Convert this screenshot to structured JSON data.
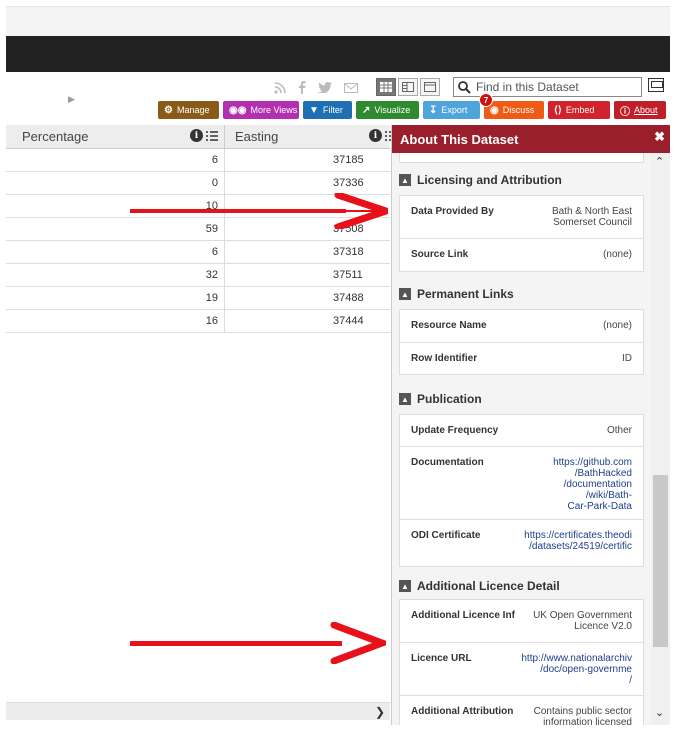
{
  "toolbar": {
    "search_placeholder": "Find in this Dataset",
    "buttons": {
      "manage": "Manage",
      "more_views": "More Views",
      "filter": "Filter",
      "visualize": "Visualize",
      "export": "Export",
      "discuss": "Discuss",
      "discuss_count": "7",
      "embed": "Embed",
      "about": "About"
    }
  },
  "grid": {
    "columns": [
      "Percentage",
      "Easting"
    ],
    "rows": [
      {
        "percentage": "6",
        "easting": "37185"
      },
      {
        "percentage": "0",
        "easting": "37336"
      },
      {
        "percentage": "10",
        "easting": ""
      },
      {
        "percentage": "59",
        "easting": "37508"
      },
      {
        "percentage": "6",
        "easting": "37318"
      },
      {
        "percentage": "32",
        "easting": "37511"
      },
      {
        "percentage": "19",
        "easting": "37488"
      },
      {
        "percentage": "16",
        "easting": "37444"
      }
    ]
  },
  "panel": {
    "title": "About This Dataset",
    "sections": {
      "licensing": {
        "title": "Licensing and Attribution",
        "items": [
          {
            "key": "Data Provided By",
            "value": "Bath & North East\nSomerset Council"
          },
          {
            "key": "Source Link",
            "value": "(none)"
          }
        ]
      },
      "permanent": {
        "title": "Permanent Links",
        "items": [
          {
            "key": "Resource Name",
            "value": "(none)"
          },
          {
            "key": "Row Identifier",
            "value": "ID"
          }
        ]
      },
      "publication": {
        "title": "Publication",
        "items": [
          {
            "key": "Update Frequency",
            "value": "Other"
          },
          {
            "key": "Documentation",
            "value": "https://github.com\n/BathHacked\n/documentation\n/wiki/Bath-\nCar-Park-Data"
          },
          {
            "key": "ODI Certificate",
            "value": "https://certificates.theodi\n/datasets/24519/certific"
          }
        ]
      },
      "additional": {
        "title": "Additional Licence Detail",
        "items": [
          {
            "key": "Additional Licence Inf",
            "value": "UK Open Government\nLicence V2.0"
          },
          {
            "key": "Licence URL",
            "value": "http://www.nationalarchiv\n/doc/open-governme\n/"
          },
          {
            "key": "Additional Attribution",
            "value": "Contains public sector\ninformation licensed"
          }
        ]
      }
    }
  },
  "colors": {
    "panel_header": "#9a1f2c",
    "annotation_arrow": "#e8111a"
  }
}
